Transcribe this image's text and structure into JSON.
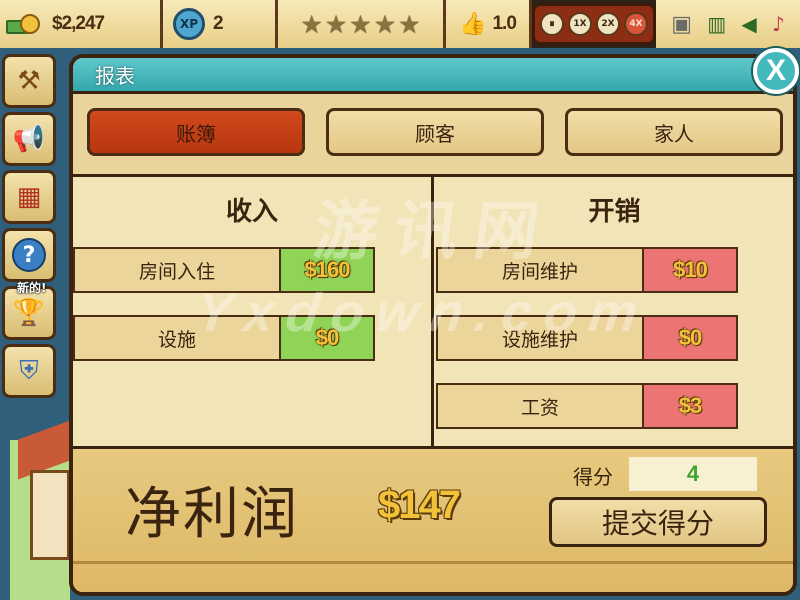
{
  "hud": {
    "money": "$2,247",
    "xp_label": "XP",
    "xp_value": "2",
    "stars_count": 5,
    "rating": "1.0",
    "speed_buttons": [
      "⏸",
      "1X",
      "2X",
      "4X"
    ],
    "active_speed": "4X"
  },
  "sidebar": {
    "new_tag": "新的!"
  },
  "dialog": {
    "title": "报表",
    "close_label": "X",
    "tabs": [
      "账簿",
      "顾客",
      "家人"
    ],
    "active_tab": "账簿",
    "income": {
      "title": "收入",
      "rows": [
        {
          "label": "房间入住",
          "value": "$160"
        },
        {
          "label": "设施",
          "value": "$0"
        }
      ]
    },
    "expenses": {
      "title": "开销",
      "rows": [
        {
          "label": "房间维护",
          "value": "$10"
        },
        {
          "label": "设施维护",
          "value": "$0"
        },
        {
          "label": "工资",
          "value": "$3"
        }
      ]
    },
    "net_profit_label": "净利润",
    "net_profit_value": "$147",
    "score_label": "得分",
    "score_value": "4",
    "submit_label": "提交得分"
  },
  "watermark": {
    "line1": "游讯网",
    "line2": "Yxdown.com"
  },
  "colors": {
    "dialog_bg": "#e9d59c",
    "header_teal": "#33a7ad",
    "active_tab": "#c43d15",
    "income_green": "#8fd457",
    "expense_red": "#ec7472",
    "money_gold": "#f2c23a"
  }
}
